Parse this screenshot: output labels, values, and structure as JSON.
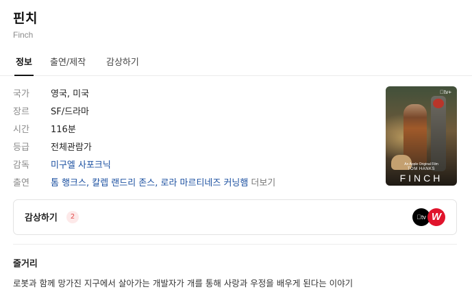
{
  "header": {
    "title": "핀치",
    "subtitle": "Finch"
  },
  "tabs": [
    {
      "label": "정보",
      "active": true
    },
    {
      "label": "출연/제작",
      "active": false
    },
    {
      "label": "감상하기",
      "active": false
    }
  ],
  "info": {
    "country": {
      "key": "국가",
      "value": "영국, 미국"
    },
    "genre": {
      "key": "장르",
      "value": "SF/드라마"
    },
    "runtime": {
      "key": "시간",
      "value": "116분"
    },
    "rating": {
      "key": "등급",
      "value": "전체관람가"
    },
    "director": {
      "key": "감독",
      "value": "미구엘 사포크닉"
    },
    "cast": {
      "key": "출연",
      "value": "톰 행크스, 칼렙 랜드리 존스, 로라 마르티네즈 커닝햄",
      "more": "더보기"
    }
  },
  "poster": {
    "service_mark": "tv+",
    "original_line": "An Apple Original Film",
    "star_line": "TOM HANKS",
    "film_title": "FINCH"
  },
  "watch": {
    "label": "감상하기",
    "count": "2",
    "services": [
      {
        "name": "apple-tv-plus",
        "glyph": "tv",
        "color": "#000000"
      },
      {
        "name": "watcha",
        "glyph": "W",
        "color": "#e0142c"
      }
    ]
  },
  "synopsis": {
    "heading": "줄거리",
    "text": "로봇과 함께 망가진 지구에서 살아가는 개발자가 개를 통해 사랑과 우정을 배우게 된다는 이야기"
  },
  "colors": {
    "link": "#1a4fa0",
    "badge_bg": "#fde9e9",
    "badge_text": "#e14b4b"
  }
}
